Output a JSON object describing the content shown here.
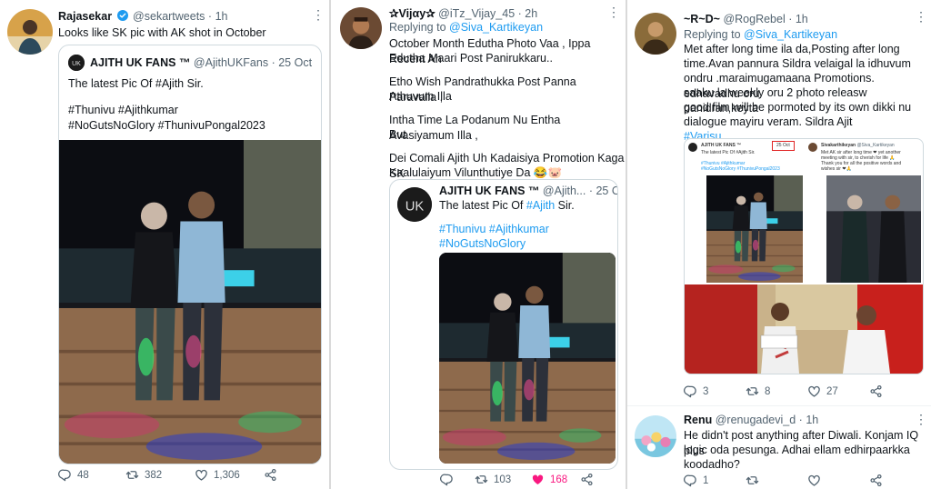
{
  "colors": {
    "link": "#1d9bf0",
    "muted": "#536471",
    "like": "#f91880",
    "border": "#cfd9de"
  },
  "tweet1": {
    "name": "Rajasekar",
    "handle": "@sekartweets",
    "time": "1h",
    "text": "Looks like SK pic with AK shot in October",
    "quote": {
      "name": "AJITH UK FANS ™",
      "handle": "@AjithUKFans",
      "date": "25 Oct",
      "line1": "The latest Pic Of #Ajith Sir.",
      "line2": "#Thunivu #Ajithkumar",
      "line3": "#NoGutsNoGlory #ThunivuPongal2023"
    },
    "replies": "48",
    "retweets": "382",
    "likes": "1,306"
  },
  "tweet2": {
    "name": "✰Vijαy✰",
    "handle": "@iTz_Vijay_45",
    "time": "2h",
    "replying_prefix": "Replying to ",
    "replying_handle": "@Siva_Kartikeyan",
    "para1a": "October Month Edutha Photo Vaa , Ippa Recent Ah",
    "para1b": "Edutha Maari Post Panirukkaru..",
    "para2a": "Etho Wish Pandrathukka Post Panna Paravalla ,",
    "para2b": "Athuvum Illa",
    "para3a": "Intha Time La Podanum Nu Entha Avasiyamum Illa ,",
    "para3b": "But",
    "para4a": "Dei Comali Ajith Uh Kadaisiya Promotion Kaga SK",
    "para4b": "Kaalulaiyum Vilunthutiye Da 😂🐷",
    "quote": {
      "name": "AJITH UK FANS ™",
      "handle": "@Ajith...",
      "date": "25 Oct",
      "line1_prefix": "The latest Pic Of ",
      "line1_tag": "#Ajith",
      "line1_suffix": " Sir.",
      "line2": "#Thunivu #Ajithkumar",
      "line3": "#NoGutsNoGlory #ThunivuPongal2023"
    },
    "replies": "",
    "retweets": "103",
    "likes": "168"
  },
  "tweet3": {
    "name": "~R~D~",
    "handle": "@RogRebel",
    "time": "1h",
    "replying_prefix": "Replying to ",
    "replying_handle": "@Siva_Kartikeyan",
    "l1": "Met after long time ila da,Posting after long",
    "l2": "time.Avan pannura Sildra velaigal la idhuvum",
    "l3": "ondru .maraimugamaana Promotions. edhavadhu oru",
    "l4": "saaku la weekly oru 2 photo releasw panidran,keyta",
    "l5": "good film will be pormoted by its own dikki nu",
    "l6": "dialogue mayiru veram. Sildra Ajit",
    "hashtag": "#Varisu",
    "collage": {
      "left_name": "AJITH UK FANS ™",
      "left_date": "25 Oct",
      "left_text": "The latest Pic Of #Ajith Sir.",
      "left_tags1": "#Thunivu #Ajithkumar",
      "left_tags2": "#NoGutsNoGlory #ThunivuPongal2023",
      "right_name": "Sivakarthikeyan",
      "right_handle": "@Siva_Kartikeyan",
      "right_text1": "Met AK sir after long time ❤ yet another",
      "right_text2": "meeting with sir, to cherish for life 🙏",
      "right_text3": "Thank you for all the positive words and",
      "right_text4": "wishes sir ❤🙏"
    },
    "replies": "3",
    "retweets": "8",
    "likes": "27"
  },
  "tweet4": {
    "name": "Renu",
    "handle": "@renugadevi_d",
    "time": "1h",
    "l1": "He didn't post anything after Diwali. Konjam IQ plus",
    "l2": "logic oda pesunga. Adhai ellam edhirpaarkka",
    "l3": "koodadho?",
    "replies": "1",
    "retweets": "",
    "likes": ""
  }
}
